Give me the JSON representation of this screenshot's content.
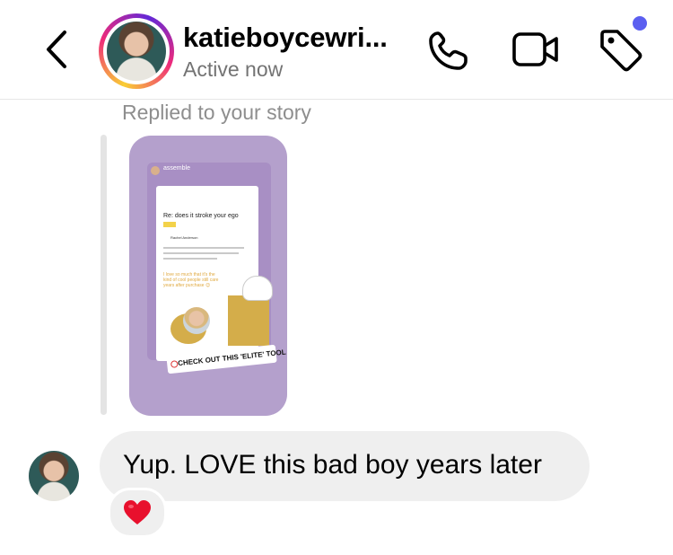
{
  "header": {
    "username": "katieboycewri...",
    "status": "Active now"
  },
  "icons": {
    "back": "chevron-left-icon",
    "call": "phone-icon",
    "video": "video-camera-icon",
    "tag": "tag-icon"
  },
  "colors": {
    "notification_dot": "#5b5ff0",
    "story_background": "#b4a0cc",
    "bubble_background": "#efefef",
    "secondary_text": "#737373",
    "heart": "#e8102d"
  },
  "story_reply": {
    "label": "Replied to your story",
    "story_preview": {
      "brand": "assemble",
      "email_subject": "Re: does it stroke your ego",
      "email_from": "Rachel Anderson",
      "email_quote": "I love so much that it's the kind of cool people still care years after purchase 😊",
      "sticker_text": "CHECK OUT THIS 'ELITE' TOOL"
    }
  },
  "message": {
    "text": "Yup. LOVE this bad boy years later",
    "reaction": "❤️"
  }
}
